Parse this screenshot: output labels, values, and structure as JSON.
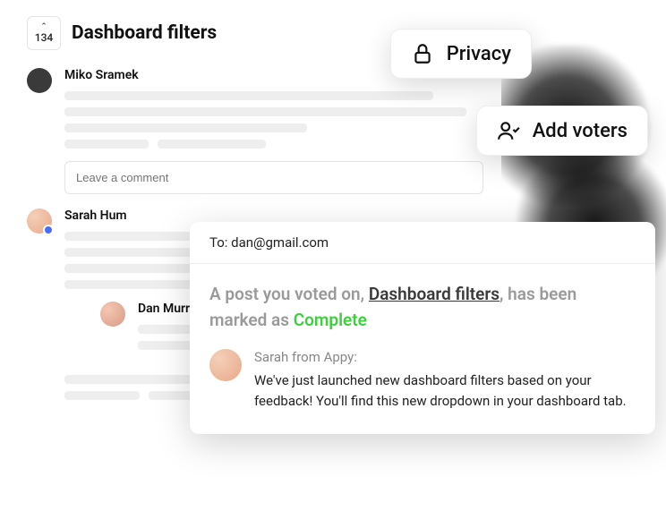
{
  "vote_count": "134",
  "title": "Dashboard filters",
  "threads": [
    {
      "author": "Miko Sramek"
    },
    {
      "author": "Sarah Hum"
    },
    {
      "author": "Dan Murray"
    }
  ],
  "comment_placeholder": "Leave a comment",
  "pills": {
    "privacy": "Privacy",
    "add_voters": "Add voters"
  },
  "email": {
    "to_prefix": "To: ",
    "to": "dan@gmail.com",
    "headline_pre": "A post you voted on, ",
    "headline_link": "Dashboard filters",
    "headline_mid": ", has been marked as ",
    "headline_status": "Complete",
    "from": "Sarah from Appy:",
    "message": "We've just launched new dashboard filters based on your feedback! You'll find this new dropdown in your dashboard tab."
  }
}
